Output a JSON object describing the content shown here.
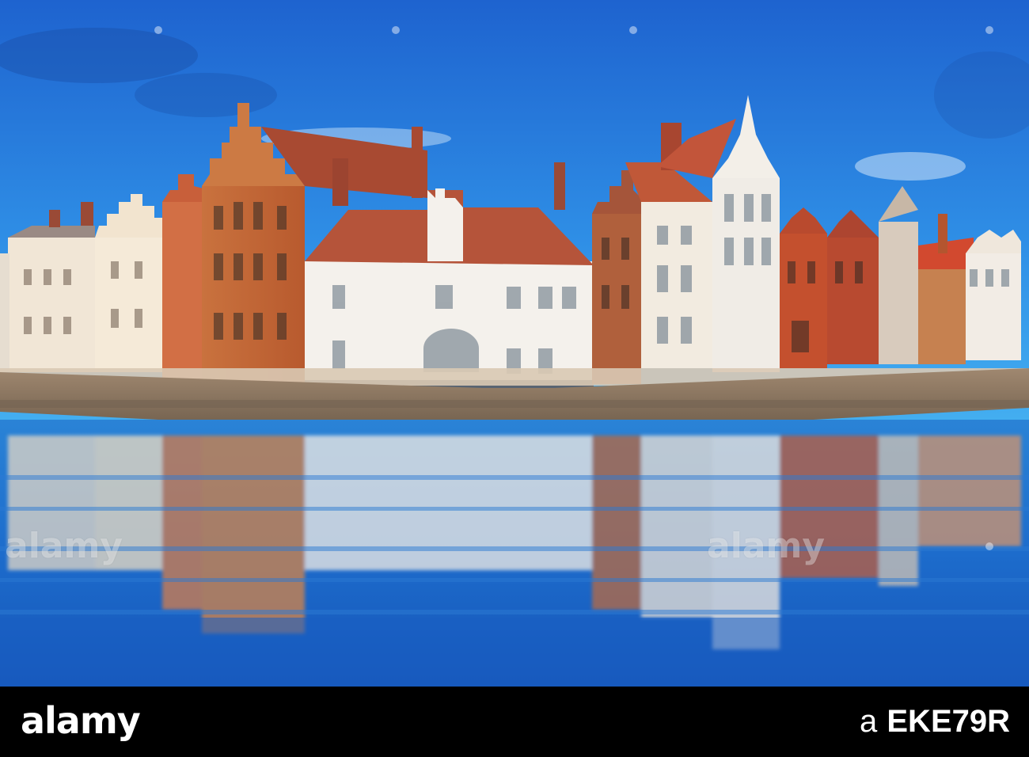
{
  "photo": {
    "sky_top_color": "#1f6fd6",
    "sky_bottom_color": "#3aa7f0",
    "water_color": "#1c6fcf",
    "stone_wall_color": "#8a7660"
  },
  "watermarks": {
    "left_text": "alamy",
    "center_text": "alamy"
  },
  "footer": {
    "brand": "alamy",
    "prefix": "a",
    "image_id": "EKE79R"
  }
}
